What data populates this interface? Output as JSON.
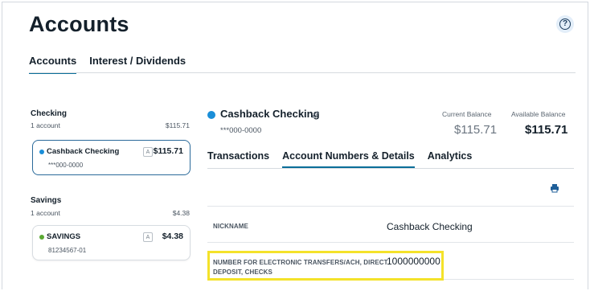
{
  "page": {
    "title": "Accounts",
    "help_icon": "?"
  },
  "top_tabs": [
    {
      "label": "Accounts",
      "active": true
    },
    {
      "label": "Interest / Dividends",
      "active": false
    }
  ],
  "sections": {
    "checking": {
      "label": "Checking",
      "count": "1 account",
      "total": "$115.71",
      "accounts": [
        {
          "name": "Cashback Checking",
          "number": "***000-0000",
          "badge": "A",
          "balance": "$115.71",
          "dot_color": "#1a8ed8"
        }
      ]
    },
    "savings": {
      "label": "Savings",
      "count": "1 account",
      "total": "$4.38",
      "accounts": [
        {
          "name": "SAVINGS",
          "number": "81234567-01",
          "badge": "A",
          "balance": "$4.38",
          "dot_color": "#5aa832"
        }
      ]
    }
  },
  "detail": {
    "name": "Cashback Checking",
    "number": "***000-0000",
    "current_balance_label": "Current Balance",
    "current_balance": "$115.71",
    "available_balance_label": "Available Balance",
    "available_balance": "$115.71",
    "tabs": [
      {
        "label": "Transactions",
        "active": false
      },
      {
        "label": "Account Numbers & Details",
        "active": true
      },
      {
        "label": "Analytics",
        "active": false
      }
    ],
    "rows": [
      {
        "label": "NICKNAME",
        "value": "Cashback Checking"
      },
      {
        "label_line1": "NUMBER FOR ELECTRONIC TRANSFERS/ACH, DIRECT",
        "label_line2": "DEPOSIT, CHECKS",
        "value": "1000000000"
      }
    ]
  },
  "colors": {
    "accent": "#0b6e99",
    "highlight": "#f4e22a",
    "checking_dot": "#1a8ed8",
    "savings_dot": "#5aa832"
  }
}
